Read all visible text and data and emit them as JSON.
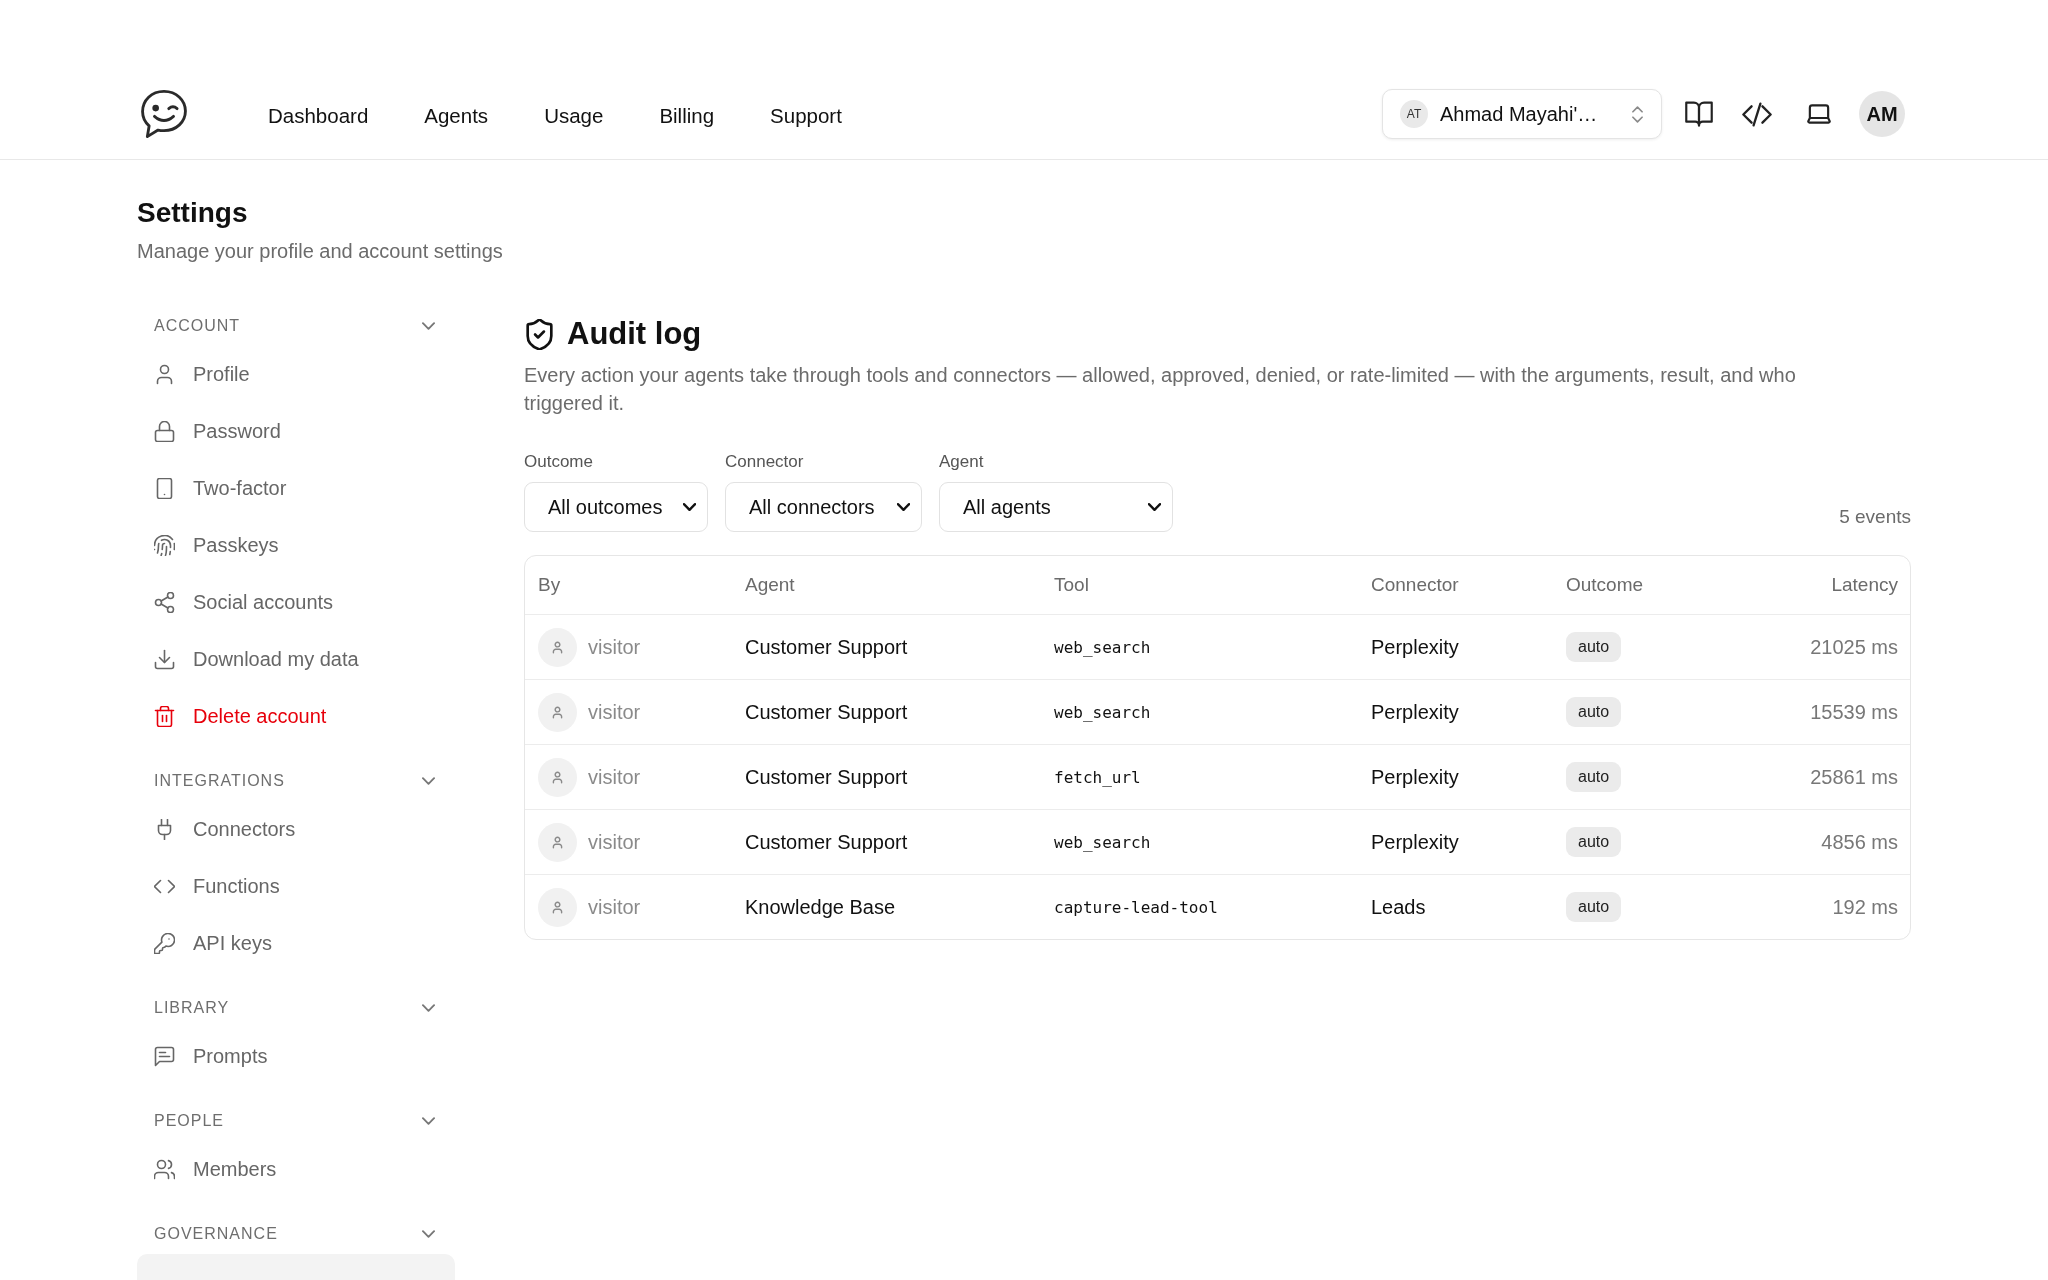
{
  "header": {
    "nav": [
      {
        "label": "Dashboard"
      },
      {
        "label": "Agents"
      },
      {
        "label": "Usage"
      },
      {
        "label": "Billing"
      },
      {
        "label": "Support"
      }
    ],
    "workspace": {
      "initials": "AT",
      "name": "Ahmad Mayahi'…"
    },
    "user_initials": "AM"
  },
  "page": {
    "title": "Settings",
    "subtitle": "Manage your profile and account settings"
  },
  "sidebar": {
    "sections": [
      {
        "title": "ACCOUNT",
        "expanded": true,
        "items": [
          {
            "label": "Profile",
            "selected": false,
            "danger": false
          },
          {
            "label": "Password",
            "selected": false,
            "danger": false
          },
          {
            "label": "Two-factor",
            "selected": false,
            "danger": false
          },
          {
            "label": "Passkeys",
            "selected": false,
            "danger": false
          },
          {
            "label": "Social accounts",
            "selected": false,
            "danger": false
          },
          {
            "label": "Download my data",
            "selected": false,
            "danger": false
          },
          {
            "label": "Delete account",
            "selected": false,
            "danger": true
          }
        ]
      },
      {
        "title": "INTEGRATIONS",
        "expanded": true,
        "items": [
          {
            "label": "Connectors",
            "selected": false,
            "danger": false
          },
          {
            "label": "Functions",
            "selected": false,
            "danger": false
          },
          {
            "label": "API keys",
            "selected": false,
            "danger": false
          }
        ]
      },
      {
        "title": "LIBRARY",
        "expanded": true,
        "items": [
          {
            "label": "Prompts",
            "selected": false,
            "danger": false
          }
        ]
      },
      {
        "title": "PEOPLE",
        "expanded": true,
        "items": [
          {
            "label": "Members",
            "selected": false,
            "danger": false
          }
        ]
      },
      {
        "title": "GOVERNANCE",
        "expanded": true,
        "items": [
          {
            "selected": true
          }
        ]
      }
    ]
  },
  "audit_log": {
    "title": "Audit log",
    "description": "Every action your agents take through tools and connectors — allowed, approved, denied, or rate-limited — with the arguments, result, and who triggered it.",
    "filters": [
      {
        "label": "Outcome",
        "value": "All outcomes"
      },
      {
        "label": "Connector",
        "value": "All connectors"
      },
      {
        "label": "Agent",
        "value": "All agents"
      }
    ],
    "event_count": "5 events",
    "table": {
      "columns": [
        "By",
        "Agent",
        "Tool",
        "Connector",
        "Outcome",
        "Latency"
      ],
      "rows": [
        {
          "by": "visitor",
          "agent": "Customer Support",
          "tool": "web_search",
          "connector": "Perplexity",
          "outcome": "auto",
          "latency": "21025 ms"
        },
        {
          "by": "visitor",
          "agent": "Customer Support",
          "tool": "web_search",
          "connector": "Perplexity",
          "outcome": "auto",
          "latency": "15539 ms"
        },
        {
          "by": "visitor",
          "agent": "Customer Support",
          "tool": "fetch_url",
          "connector": "Perplexity",
          "outcome": "auto",
          "latency": "25861 ms"
        },
        {
          "by": "visitor",
          "agent": "Customer Support",
          "tool": "web_search",
          "connector": "Perplexity",
          "outcome": "auto",
          "latency": "4856 ms"
        },
        {
          "by": "visitor",
          "agent": "Knowledge Base",
          "tool": "capture-lead-tool",
          "connector": "Leads",
          "outcome": "auto",
          "latency": "192 ms"
        }
      ]
    }
  }
}
